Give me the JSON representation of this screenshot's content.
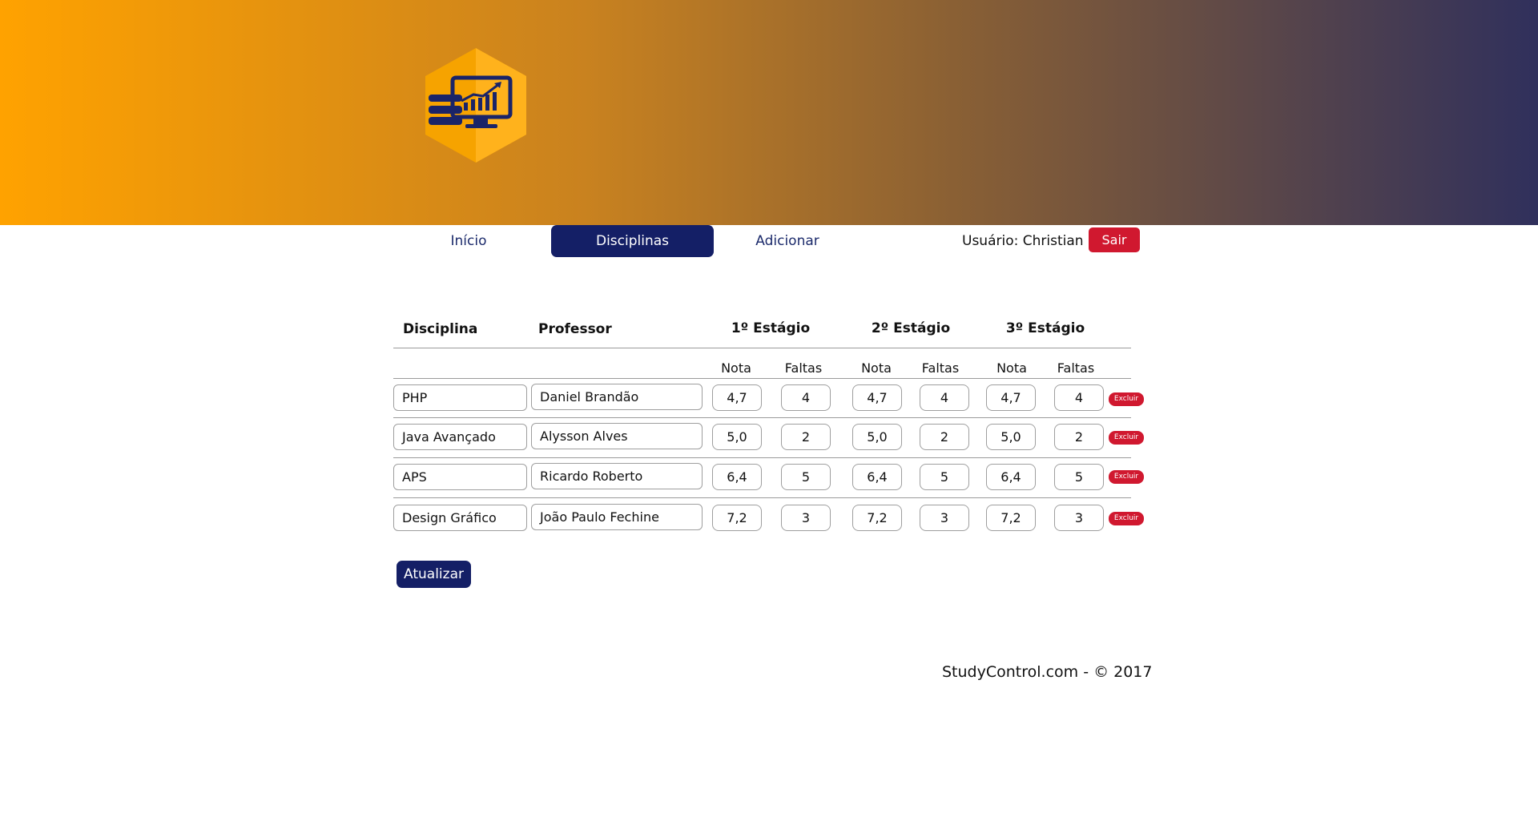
{
  "nav": {
    "items": [
      {
        "label": "Início",
        "active": false
      },
      {
        "label": "Disciplinas",
        "active": true
      },
      {
        "label": "Adicionar",
        "active": false
      }
    ],
    "user_label": "Usuário: Christian",
    "logout_label": "Sair"
  },
  "table": {
    "headers": {
      "disciplina": "Disciplina",
      "professor": "Professor",
      "stages": [
        "1º Estágio",
        "2º Estágio",
        "3º Estágio"
      ]
    },
    "subheaders": {
      "nota": "Nota",
      "faltas": "Faltas"
    },
    "rows": [
      {
        "disciplina": "PHP",
        "professor": "Daniel Brandão",
        "grades": [
          {
            "nota": "4,7",
            "faltas": "4"
          },
          {
            "nota": "4,7",
            "faltas": "4"
          },
          {
            "nota": "4,7",
            "faltas": "4"
          }
        ]
      },
      {
        "disciplina": "Java Avançado",
        "professor": "Alysson Alves",
        "grades": [
          {
            "nota": "5,0",
            "faltas": "2"
          },
          {
            "nota": "5,0",
            "faltas": "2"
          },
          {
            "nota": "5,0",
            "faltas": "2"
          }
        ]
      },
      {
        "disciplina": "APS",
        "professor": "Ricardo Roberto",
        "grades": [
          {
            "nota": "6,4",
            "faltas": "5"
          },
          {
            "nota": "6,4",
            "faltas": "5"
          },
          {
            "nota": "6,4",
            "faltas": "5"
          }
        ]
      },
      {
        "disciplina": "Design Gráfico",
        "professor": "João Paulo Fechine",
        "grades": [
          {
            "nota": "7,2",
            "faltas": "3"
          },
          {
            "nota": "7,2",
            "faltas": "3"
          },
          {
            "nota": "7,2",
            "faltas": "3"
          }
        ]
      }
    ],
    "delete_label": "Excluir"
  },
  "update_label": "Atualizar",
  "footer": "StudyControl.com - © 2017",
  "colors": {
    "primary": "#141f66",
    "danger": "#d0182f",
    "header_start": "#ffa200",
    "header_end": "#30305c"
  }
}
